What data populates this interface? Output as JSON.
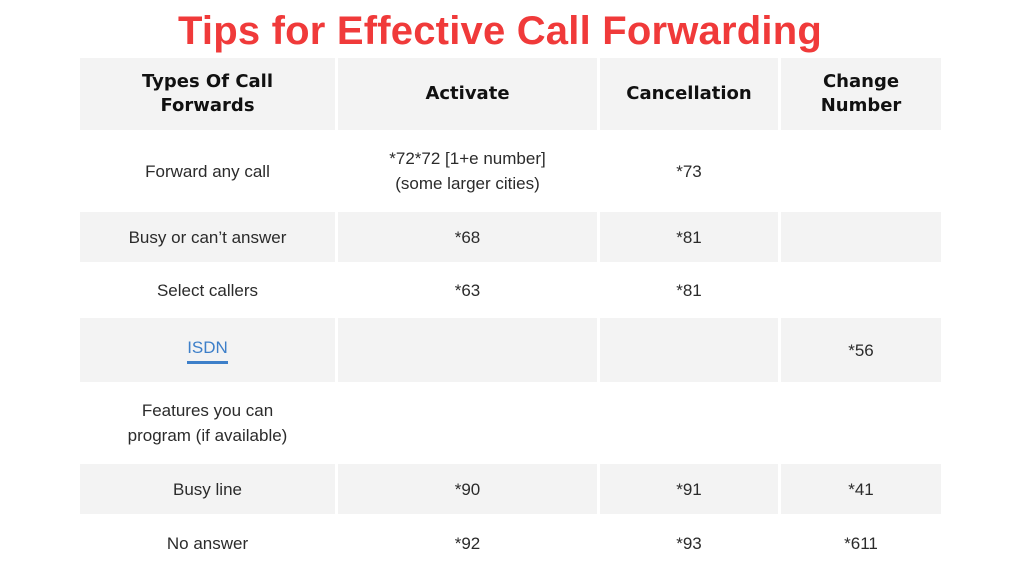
{
  "title": "Tips for Effective Call Forwarding",
  "colors": {
    "title": "#f03a3a",
    "link": "#3d7fc9",
    "band": "#f3f3f3"
  },
  "table": {
    "headers": [
      "Types Of Call Forwards",
      "Activate",
      "Cancellation",
      "Change Number"
    ],
    "rows": [
      {
        "type": "Forward any call",
        "activate": "*72*72 [1+e number] (some larger cities)",
        "cancellation": "*73",
        "change_number": ""
      },
      {
        "type": "Busy or can’t answer",
        "activate": "*68",
        "cancellation": "*81",
        "change_number": ""
      },
      {
        "type": "Select callers",
        "activate": "*63",
        "cancellation": "*81",
        "change_number": ""
      },
      {
        "type": "ISDN",
        "activate": "",
        "cancellation": "",
        "change_number": "*56",
        "is_link": true
      },
      {
        "type": "Features you can program (if available)",
        "activate": "",
        "cancellation": "",
        "change_number": ""
      },
      {
        "type": "Busy line",
        "activate": "*90",
        "cancellation": "*91",
        "change_number": "*41"
      },
      {
        "type": "No answer",
        "activate": "*92",
        "cancellation": "*93",
        "change_number": "*611"
      }
    ]
  }
}
